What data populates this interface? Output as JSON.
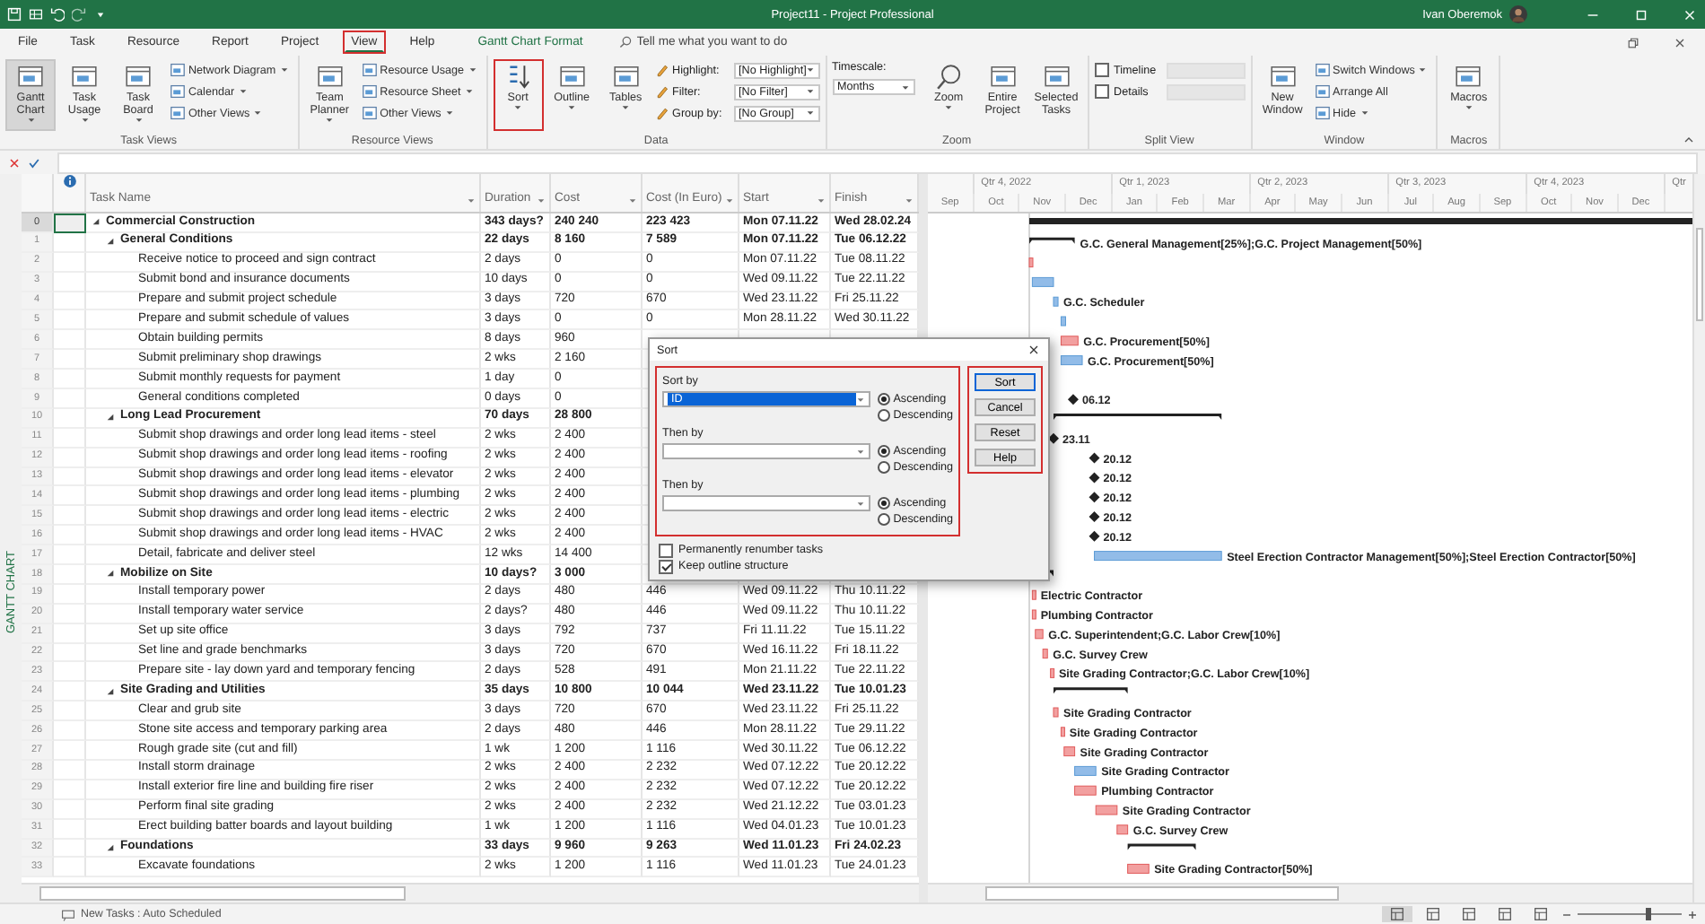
{
  "window": {
    "title": "Project11 - Project Professional",
    "user": "Ivan Oberemok"
  },
  "tabs": [
    {
      "label": "File",
      "selected": false,
      "highlighted": false
    },
    {
      "label": "Task",
      "selected": false,
      "highlighted": false
    },
    {
      "label": "Resource",
      "selected": false,
      "highlighted": false
    },
    {
      "label": "Report",
      "selected": false,
      "highlighted": false
    },
    {
      "label": "Project",
      "selected": false,
      "highlighted": false
    },
    {
      "label": "View",
      "selected": true,
      "highlighted": true
    },
    {
      "label": "Help",
      "selected": false,
      "highlighted": false
    }
  ],
  "contextual_tab": "Gantt Chart Format",
  "tell_me": {
    "placeholder": "Tell me what you want to do"
  },
  "ribbon": {
    "groups": [
      {
        "label": "Task Views",
        "items": [
          {
            "kind": "large",
            "label": "Gantt Chart",
            "dropdown": true,
            "selected": true,
            "highlighted": false
          },
          {
            "kind": "large",
            "label": "Task Usage",
            "dropdown": true,
            "selected": false,
            "highlighted": false
          },
          {
            "kind": "large",
            "label": "Task Board",
            "dropdown": true,
            "selected": false,
            "highlighted": false
          },
          {
            "kind": "stack",
            "items": [
              {
                "label": "Network Diagram",
                "dropdown": true
              },
              {
                "label": "Calendar",
                "dropdown": true
              },
              {
                "label": "Other Views",
                "dropdown": true
              }
            ]
          }
        ]
      },
      {
        "label": "Resource Views",
        "items": [
          {
            "kind": "large",
            "label": "Team Planner",
            "dropdown": true,
            "selected": false,
            "highlighted": false
          },
          {
            "kind": "stack",
            "items": [
              {
                "label": "Resource Usage",
                "dropdown": true
              },
              {
                "label": "Resource Sheet",
                "dropdown": true
              },
              {
                "label": "Other Views",
                "dropdown": true
              }
            ]
          }
        ]
      },
      {
        "label": "Data",
        "items": [
          {
            "kind": "large",
            "label": "Sort",
            "dropdown": true,
            "selected": false,
            "highlighted": true
          },
          {
            "kind": "large",
            "label": "Outline",
            "dropdown": true,
            "selected": false,
            "highlighted": false
          },
          {
            "kind": "large",
            "label": "Tables",
            "dropdown": true,
            "selected": false,
            "highlighted": false
          },
          {
            "kind": "combos",
            "items": [
              {
                "label": "Highlight:",
                "value": "[No Highlight]"
              },
              {
                "label": "Filter:",
                "value": "[No Filter]"
              },
              {
                "label": "Group by:",
                "value": "[No Group]"
              }
            ]
          }
        ]
      },
      {
        "label": "Zoom",
        "items": [
          {
            "kind": "timescale",
            "label": "Timescale:",
            "value": "Months"
          },
          {
            "kind": "large",
            "label": "Zoom",
            "dropdown": true,
            "selected": false,
            "highlighted": false
          },
          {
            "kind": "large",
            "label": "Entire Project",
            "dropdown": false,
            "selected": false,
            "highlighted": false
          },
          {
            "kind": "large",
            "label": "Selected Tasks",
            "dropdown": false,
            "selected": false,
            "highlighted": false
          }
        ]
      },
      {
        "label": "Split View",
        "items": [
          {
            "kind": "checks",
            "items": [
              {
                "label": "Timeline",
                "checked": false
              },
              {
                "label": "Details",
                "checked": false
              }
            ]
          }
        ]
      },
      {
        "label": "Window",
        "items": [
          {
            "kind": "large",
            "label": "New Window",
            "dropdown": false,
            "selected": false,
            "highlighted": false
          },
          {
            "kind": "stack",
            "items": [
              {
                "label": "Switch Windows",
                "dropdown": true
              },
              {
                "label": "Arrange All",
                "dropdown": false
              },
              {
                "label": "Hide",
                "dropdown": true
              }
            ]
          }
        ]
      },
      {
        "label": "Macros",
        "items": [
          {
            "kind": "large",
            "label": "Macros",
            "dropdown": true,
            "selected": false,
            "highlighted": false
          }
        ]
      }
    ]
  },
  "view_label": "GANTT CHART",
  "columns": [
    "Task Name",
    "Duration",
    "Cost",
    "Cost (In Euro)",
    "Start",
    "Finish"
  ],
  "tasks": [
    {
      "id": "0",
      "name": "Commercial Construction",
      "duration": "343 days?",
      "cost": "240 240",
      "cost_eur": "223 423",
      "start": "Mon 07.11.22",
      "finish": "Wed 28.02.24",
      "selected": true,
      "expanded": true,
      "bar": {
        "kind": "summary"
      },
      "children": [
        {
          "id": "1",
          "name": "General Conditions",
          "duration": "22 days",
          "cost": "8 160",
          "cost_eur": "7 589",
          "start": "Mon 07.11.22",
          "finish": "Tue 06.12.22",
          "selected": false,
          "expanded": true,
          "bar": {
            "kind": "summary",
            "label": "G.C. General Management[25%];G.C. Project Management[50%]"
          },
          "children": [
            {
              "id": "2",
              "name": "Receive notice to proceed and sign contract",
              "duration": "2 days",
              "cost": "0",
              "cost_eur": "0",
              "start": "Mon 07.11.22",
              "finish": "Tue 08.11.22",
              "selected": false,
              "bar": {
                "kind": "task",
                "critical": true
              }
            },
            {
              "id": "3",
              "name": "Submit bond and insurance documents",
              "duration": "10 days",
              "cost": "0",
              "cost_eur": "0",
              "start": "Wed 09.11.22",
              "finish": "Tue 22.11.22",
              "selected": false,
              "bar": {
                "kind": "task",
                "critical": false
              }
            },
            {
              "id": "4",
              "name": "Prepare and submit project schedule",
              "duration": "3 days",
              "cost": "720",
              "cost_eur": "670",
              "start": "Wed 23.11.22",
              "finish": "Fri 25.11.22",
              "selected": false,
              "bar": {
                "kind": "task",
                "critical": false,
                "label": "G.C. Scheduler"
              }
            },
            {
              "id": "5",
              "name": "Prepare and submit schedule of values",
              "duration": "3 days",
              "cost": "0",
              "cost_eur": "0",
              "start": "Mon 28.11.22",
              "finish": "Wed 30.11.22",
              "selected": false,
              "bar": {
                "kind": "task",
                "critical": false
              }
            },
            {
              "id": "6",
              "name": "Obtain building permits",
              "duration": "8 days",
              "cost": "960",
              "selected": false,
              "bar": {
                "kind": "task",
                "critical": true,
                "label": "G.C. Procurement[50%]"
              }
            },
            {
              "id": "7",
              "name": "Submit preliminary shop drawings",
              "duration": "2 wks",
              "cost": "2 160",
              "selected": false,
              "bar": {
                "kind": "task",
                "critical": false,
                "label": "G.C. Procurement[50%]"
              }
            },
            {
              "id": "8",
              "name": "Submit monthly requests for payment",
              "duration": "1 day",
              "cost": "0",
              "selected": false
            },
            {
              "id": "9",
              "name": "General conditions completed",
              "duration": "0 days",
              "cost": "0",
              "selected": false,
              "bar": {
                "kind": "milestone",
                "label": "06.12"
              }
            }
          ]
        },
        {
          "id": "10",
          "name": "Long Lead Procurement",
          "duration": "70 days",
          "cost": "28 800",
          "selected": false,
          "expanded": true,
          "bar": {
            "kind": "summary"
          },
          "children": [
            {
              "id": "11",
              "name": "Submit shop drawings and order long lead items - steel",
              "duration": "2 wks",
              "cost": "2 400",
              "selected": false,
              "bar": {
                "kind": "milestone",
                "label": "23.11"
              }
            },
            {
              "id": "12",
              "name": "Submit shop drawings and order long lead items - roofing",
              "duration": "2 wks",
              "cost": "2 400",
              "selected": false,
              "bar": {
                "kind": "milestone",
                "label": "20.12"
              }
            },
            {
              "id": "13",
              "name": "Submit shop drawings and order long lead items - elevator",
              "duration": "2 wks",
              "cost": "2 400",
              "selected": false,
              "bar": {
                "kind": "milestone",
                "label": "20.12"
              }
            },
            {
              "id": "14",
              "name": "Submit shop drawings and order long lead items - plumbing",
              "duration": "2 wks",
              "cost": "2 400",
              "selected": false,
              "bar": {
                "kind": "milestone",
                "label": "20.12"
              }
            },
            {
              "id": "15",
              "name": "Submit shop drawings and order long lead items - electric",
              "duration": "2 wks",
              "cost": "2 400",
              "selected": false,
              "bar": {
                "kind": "milestone",
                "label": "20.12"
              }
            },
            {
              "id": "16",
              "name": "Submit shop drawings and order long lead items - HVAC",
              "duration": "2 wks",
              "cost": "2 400",
              "selected": false,
              "bar": {
                "kind": "milestone",
                "label": "20.12"
              }
            },
            {
              "id": "17",
              "name": "Detail, fabricate and deliver steel",
              "duration": "12 wks",
              "cost": "14 400",
              "selected": false,
              "bar": {
                "kind": "task",
                "critical": false,
                "label": "Steel Erection Contractor Management[50%];Steel Erection Contractor[50%]"
              }
            }
          ]
        },
        {
          "id": "18",
          "name": "Mobilize on Site",
          "duration": "10 days?",
          "cost": "3 000",
          "selected": false,
          "expanded": true,
          "bar": {
            "kind": "summary"
          },
          "children": [
            {
              "id": "19",
              "name": "Install temporary power",
              "duration": "2 days",
              "cost": "480",
              "cost_eur": "446",
              "start": "Wed 09.11.22",
              "finish": "Thu 10.11.22",
              "selected": false,
              "bar": {
                "kind": "task",
                "critical": true,
                "label": "Electric Contractor"
              }
            },
            {
              "id": "20",
              "name": "Install temporary water service",
              "duration": "2 days?",
              "cost": "480",
              "cost_eur": "446",
              "start": "Wed 09.11.22",
              "finish": "Thu 10.11.22",
              "selected": false,
              "bar": {
                "kind": "task",
                "critical": true,
                "label": "Plumbing Contractor"
              }
            },
            {
              "id": "21",
              "name": "Set up site office",
              "duration": "3 days",
              "cost": "792",
              "cost_eur": "737",
              "start": "Fri 11.11.22",
              "finish": "Tue 15.11.22",
              "selected": false,
              "bar": {
                "kind": "task",
                "critical": true,
                "label": "G.C. Superintendent;G.C. Labor Crew[10%]"
              }
            },
            {
              "id": "22",
              "name": "Set line and grade benchmarks",
              "duration": "3 days",
              "cost": "720",
              "cost_eur": "670",
              "start": "Wed 16.11.22",
              "finish": "Fri 18.11.22",
              "selected": false,
              "bar": {
                "kind": "task",
                "critical": true,
                "label": "G.C. Survey Crew"
              }
            },
            {
              "id": "23",
              "name": "Prepare site - lay down yard and temporary fencing",
              "duration": "2 days",
              "cost": "528",
              "cost_eur": "491",
              "start": "Mon 21.11.22",
              "finish": "Tue 22.11.22",
              "selected": false,
              "bar": {
                "kind": "task",
                "critical": true,
                "label": "Site Grading Contractor;G.C. Labor Crew[10%]"
              }
            }
          ]
        },
        {
          "id": "24",
          "name": "Site Grading and Utilities",
          "duration": "35 days",
          "cost": "10 800",
          "cost_eur": "10 044",
          "start": "Wed 23.11.22",
          "finish": "Tue 10.01.23",
          "selected": false,
          "expanded": true,
          "bar": {
            "kind": "summary"
          },
          "children": [
            {
              "id": "25",
              "name": "Clear and grub site",
              "duration": "3 days",
              "cost": "720",
              "cost_eur": "670",
              "start": "Wed 23.11.22",
              "finish": "Fri 25.11.22",
              "selected": false,
              "bar": {
                "kind": "task",
                "critical": true,
                "label": "Site Grading Contractor"
              }
            },
            {
              "id": "26",
              "name": "Stone site access and temporary parking area",
              "duration": "2 days",
              "cost": "480",
              "cost_eur": "446",
              "start": "Mon 28.11.22",
              "finish": "Tue 29.11.22",
              "selected": false,
              "bar": {
                "kind": "task",
                "critical": true,
                "label": "Site Grading Contractor"
              }
            },
            {
              "id": "27",
              "name": "Rough grade site (cut and fill)",
              "duration": "1 wk",
              "cost": "1 200",
              "cost_eur": "1 116",
              "start": "Wed 30.11.22",
              "finish": "Tue 06.12.22",
              "selected": false,
              "bar": {
                "kind": "task",
                "critical": true,
                "label": "Site Grading Contractor"
              }
            },
            {
              "id": "28",
              "name": "Install storm drainage",
              "duration": "2 wks",
              "cost": "2 400",
              "cost_eur": "2 232",
              "start": "Wed 07.12.22",
              "finish": "Tue 20.12.22",
              "selected": false,
              "bar": {
                "kind": "task",
                "critical": false,
                "label": "Site Grading Contractor"
              }
            },
            {
              "id": "29",
              "name": "Install exterior fire line and building fire riser",
              "duration": "2 wks",
              "cost": "2 400",
              "cost_eur": "2 232",
              "start": "Wed 07.12.22",
              "finish": "Tue 20.12.22",
              "selected": false,
              "bar": {
                "kind": "task",
                "critical": true,
                "label": "Plumbing Contractor"
              }
            },
            {
              "id": "30",
              "name": "Perform final site grading",
              "duration": "2 wks",
              "cost": "2 400",
              "cost_eur": "2 232",
              "start": "Wed 21.12.22",
              "finish": "Tue 03.01.23",
              "selected": false,
              "bar": {
                "kind": "task",
                "critical": true,
                "label": "Site Grading Contractor"
              }
            },
            {
              "id": "31",
              "name": "Erect building batter boards and layout building",
              "duration": "1 wk",
              "cost": "1 200",
              "cost_eur": "1 116",
              "start": "Wed 04.01.23",
              "finish": "Tue 10.01.23",
              "selected": false,
              "bar": {
                "kind": "task",
                "critical": true,
                "label": "G.C. Survey Crew"
              }
            }
          ]
        },
        {
          "id": "32",
          "name": "Foundations",
          "duration": "33 days",
          "cost": "9 960",
          "cost_eur": "9 263",
          "start": "Wed 11.01.23",
          "finish": "Fri 24.02.23",
          "selected": false,
          "expanded": true,
          "bar": {
            "kind": "summary"
          },
          "children": [
            {
              "id": "33",
              "name": "Excavate foundations",
              "duration": "2 wks",
              "cost": "1 200",
              "cost_eur": "1 116",
              "start": "Wed 11.01.23",
              "finish": "Tue 24.01.23",
              "selected": false,
              "bar": {
                "kind": "task",
                "critical": true,
                "label": "Site Grading Contractor[50%]"
              }
            }
          ]
        }
      ]
    }
  ],
  "timescale": {
    "quarters": [
      "Qtr 4, 2022",
      "Qtr 1, 2023",
      "Qtr 2, 2023",
      "Qtr 3, 2023",
      "Qtr 4, 2023",
      "Qtr"
    ],
    "months": [
      "Sep",
      "Oct",
      "Nov",
      "Dec",
      "Jan",
      "Feb",
      "Mar",
      "Apr",
      "May",
      "Jun",
      "Jul",
      "Aug",
      "Sep",
      "Oct",
      "Nov",
      "Dec"
    ]
  },
  "sort_dialog": {
    "title": "Sort",
    "keys_highlighted": true,
    "buttons_highlighted": true,
    "keys": [
      {
        "label": "Sort by",
        "value": "ID",
        "order": [
          {
            "label": "Ascending",
            "selected": true
          },
          {
            "label": "Descending",
            "selected": false
          }
        ]
      },
      {
        "label": "Then by",
        "order": [
          {
            "label": "Ascending",
            "selected": true
          },
          {
            "label": "Descending",
            "selected": false
          }
        ]
      },
      {
        "label": "Then by",
        "order": [
          {
            "label": "Ascending",
            "selected": true
          },
          {
            "label": "Descending",
            "selected": false
          }
        ]
      }
    ],
    "buttons": [
      {
        "label": "Sort",
        "default": true
      },
      {
        "label": "Cancel",
        "default": false
      },
      {
        "label": "Reset",
        "default": false
      },
      {
        "label": "Help",
        "default": false
      }
    ],
    "options": [
      {
        "label": "Permanently renumber tasks",
        "checked": false
      },
      {
        "label": "Keep outline structure",
        "checked": true
      }
    ]
  },
  "status_bar": {
    "text": "New Tasks : Auto Scheduled",
    "zoom": {
      "level": 0.68
    }
  }
}
